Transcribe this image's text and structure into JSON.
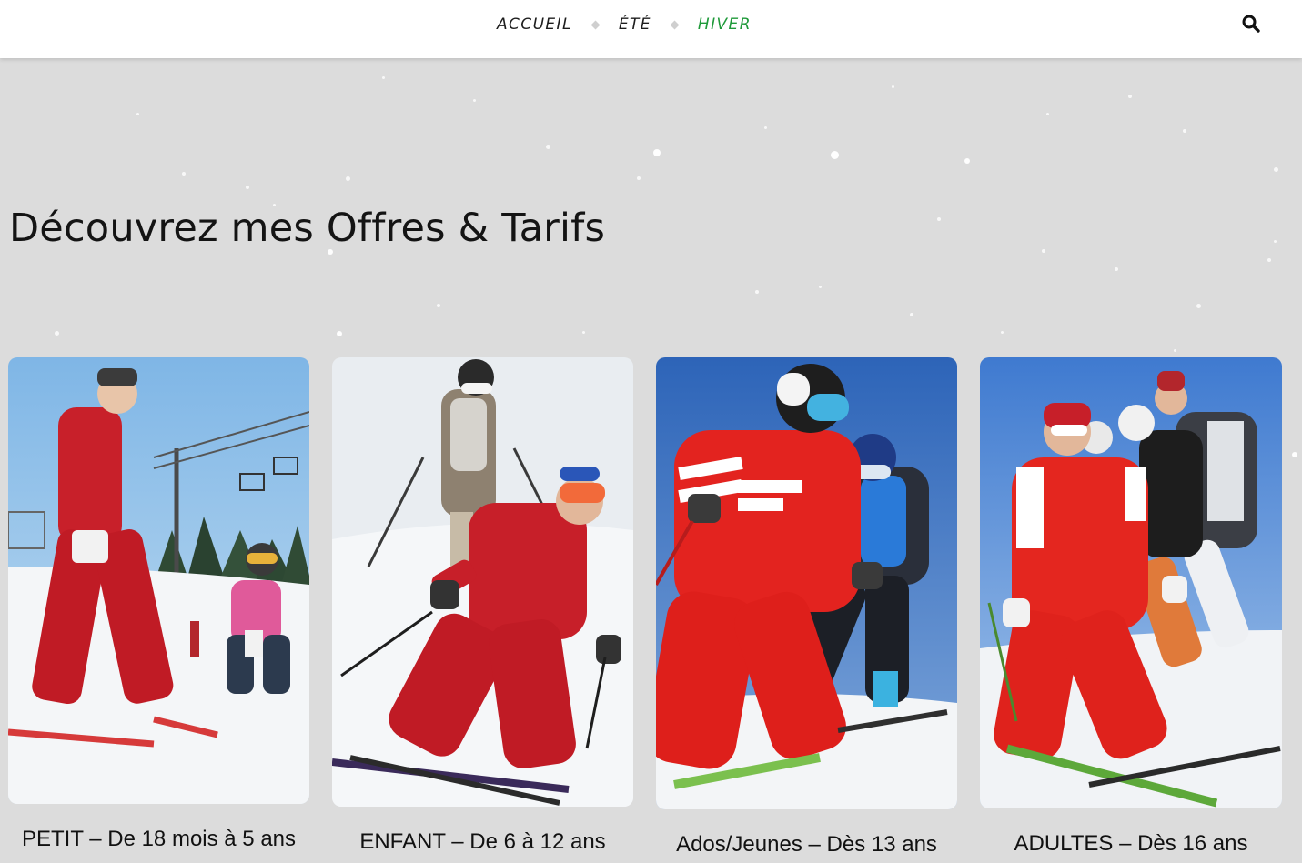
{
  "header": {
    "nav": [
      {
        "label": "ACCUEIL",
        "active": false
      },
      {
        "label": "ÉTÉ",
        "active": false
      },
      {
        "label": "HIVER",
        "active": true
      }
    ],
    "search_icon": "search-icon",
    "active_color": "#1f9a3a"
  },
  "main": {
    "heading": "Découvrez mes Offres & Tarifs",
    "offers": [
      {
        "caption": "PETIT – De 18 mois à 5 ans",
        "image": "instructor-with-small-child-skiing"
      },
      {
        "caption": "ENFANT – De 6 à 12 ans",
        "image": "instructor-carving-turn"
      },
      {
        "caption": "Ados/Jeunes – Dès 13 ans",
        "image": "instructor-with-teen-skier"
      },
      {
        "caption": "ADULTES – Dès 16 ans",
        "image": "instructor-with-adult-group"
      }
    ]
  }
}
